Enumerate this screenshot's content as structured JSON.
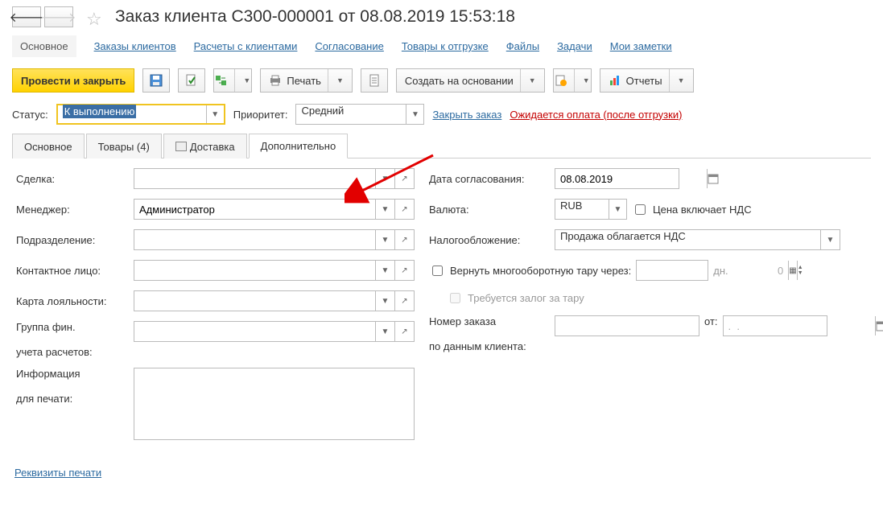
{
  "header": {
    "title": "Заказ клиента С300-000001 от 08.08.2019 15:53:18"
  },
  "nav": {
    "main": "Основное",
    "links": [
      "Заказы клиентов",
      "Расчеты с клиентами",
      "Согласование",
      "Товары к отгрузке",
      "Файлы",
      "Задачи",
      "Мои заметки"
    ]
  },
  "toolbar": {
    "post_and_close": "Провести и закрыть",
    "print": "Печать",
    "create_based": "Создать на основании",
    "reports": "Отчеты"
  },
  "status_row": {
    "status_label": "Статус:",
    "status_value": "К выполнению",
    "priority_label": "Приоритет:",
    "priority_value": "Средний",
    "close_order": "Закрыть заказ",
    "payment_note": "Ожидается оплата (после отгрузки)"
  },
  "tabs": {
    "main": "Основное",
    "goods": "Товары (4)",
    "delivery": "Доставка",
    "additional": "Дополнительно"
  },
  "form": {
    "deal_label": "Сделка:",
    "manager_label": "Менеджер:",
    "manager_value": "Администратор",
    "division_label": "Подразделение:",
    "contact_label": "Контактное лицо:",
    "loyalty_label": "Карта лояльности:",
    "fingroup_label_line1": "Группа фин.",
    "fingroup_label_line2": "учета расчетов:",
    "info_label_line1": "Информация",
    "info_label_line2": "для печати:",
    "approval_date_label": "Дата согласования:",
    "approval_date_value": "08.08.2019",
    "currency_label": "Валюта:",
    "currency_value": "RUB",
    "vat_checkbox": "Цена включает НДС",
    "tax_label": "Налогообложение:",
    "tax_value": "Продажа облагается НДС",
    "return_container_label": "Вернуть многооборотную тару через:",
    "return_container_value": "0",
    "return_container_unit": "дн.",
    "deposit_required": "Требуется залог за тару",
    "order_number_label_line1": "Номер заказа",
    "order_number_label_line2": "по данным клиента:",
    "ot_label": "от:",
    "ot_value": ".  .",
    "print_requisites": "Реквизиты печати"
  }
}
